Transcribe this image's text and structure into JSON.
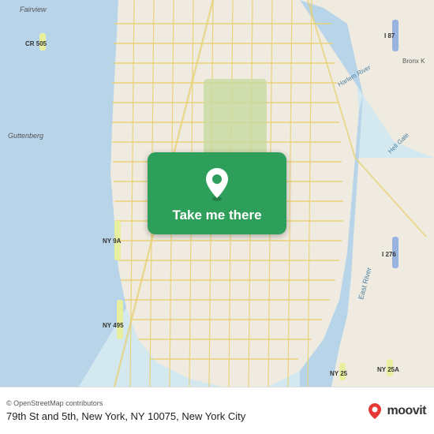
{
  "map": {
    "alt": "Map of New York City showing 79th St and 5th Ave area"
  },
  "overlay": {
    "button_label": "Take me there",
    "pin_icon": "location-pin-icon"
  },
  "footer": {
    "attribution": "© OpenStreetMap contributors",
    "location_text": "79th St and 5th, New York, NY 10075, New York City",
    "moovit_label": "moovit"
  }
}
